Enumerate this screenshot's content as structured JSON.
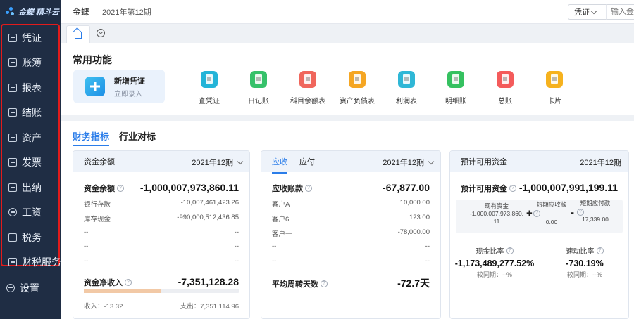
{
  "app": {
    "logo_text": "金蝶 精斗云",
    "company": "金蝶",
    "period": "2021年第12期",
    "voucher_select": "凭证",
    "search_placeholder": "输入金额"
  },
  "sidebar": {
    "items": [
      {
        "label": "凭证",
        "icon": "voucher-icon"
      },
      {
        "label": "账簿",
        "icon": "ledger-icon"
      },
      {
        "label": "报表",
        "icon": "report-icon"
      },
      {
        "label": "结账",
        "icon": "closing-icon"
      },
      {
        "label": "资产",
        "icon": "asset-icon"
      },
      {
        "label": "发票",
        "icon": "invoice-icon"
      },
      {
        "label": "出纳",
        "icon": "cashier-icon"
      },
      {
        "label": "工资",
        "icon": "salary-icon"
      },
      {
        "label": "税务",
        "icon": "tax-icon"
      },
      {
        "label": "财税服务",
        "icon": "finance-service-icon"
      }
    ],
    "settings_label": "设置"
  },
  "common": {
    "title": "常用功能",
    "new_voucher": {
      "title": "新增凭证",
      "subtitle": "立即录入"
    },
    "functions": [
      {
        "label": "查凭证",
        "color": "#23b4d8"
      },
      {
        "label": "日记账",
        "color": "#36c16a"
      },
      {
        "label": "科目余额表",
        "color": "#f0665c"
      },
      {
        "label": "资产负债表",
        "color": "#f5a623"
      },
      {
        "label": "利润表",
        "color": "#2fb7d6"
      },
      {
        "label": "明细账",
        "color": "#35c160"
      },
      {
        "label": "总账",
        "color": "#f45b5b"
      },
      {
        "label": "卡片",
        "color": "#f6b21e"
      }
    ]
  },
  "section_tabs": [
    "财务指标",
    "行业对标"
  ],
  "cards": {
    "fund_balance": {
      "title": "资金余额",
      "period": "2021年12期",
      "main_label": "资金余额",
      "main_value": "-1,000,007,973,860.11",
      "rows": [
        {
          "label": "银行存款",
          "value": "-10,007,461,423.26"
        },
        {
          "label": "库存现金",
          "value": "-990,000,512,436.85"
        },
        {
          "label": "--",
          "value": "--"
        },
        {
          "label": "--",
          "value": "--"
        },
        {
          "label": "--",
          "value": "--"
        }
      ],
      "net_label": "资金净收入",
      "net_value": "-7,351,128.28",
      "income": "收入：-13.32",
      "expense": "支出：7,351,114.96",
      "progress_fraction": 0.5
    },
    "receivable": {
      "tabs": [
        "应收",
        "应付"
      ],
      "period": "2021年12期",
      "main_label": "应收账款",
      "main_value": "-67,877.00",
      "rows": [
        {
          "label": "客户A",
          "value": "10,000.00"
        },
        {
          "label": "客户6",
          "value": "123.00"
        },
        {
          "label": "客户一",
          "value": "-78,000.00"
        },
        {
          "label": "--",
          "value": "--"
        },
        {
          "label": "--",
          "value": "--"
        }
      ],
      "turnover_label": "平均周转天数",
      "turnover_value": "-72.7天"
    },
    "available": {
      "title": "预计可用资金",
      "period": "2021年12期",
      "main_label": "预计可用资金",
      "main_value": "-1,000,007,991,199.11",
      "cash_label": "现有资金",
      "cash_value": "-1,000,007,973,860.11",
      "short_recv_label": "短期应收款",
      "short_recv_value": "0.00",
      "short_pay_label": "短期应付款",
      "short_pay_value": "17,339.00",
      "plus": "+",
      "minus": "-",
      "cash_ratio_label": "现金比率",
      "cash_ratio_value": "-1,173,489,277.52%",
      "cash_ratio_compare": "较同期：--%",
      "quick_ratio_label": "速动比率",
      "quick_ratio_value": "-730.19%",
      "quick_ratio_compare": "较同期：--%"
    }
  }
}
